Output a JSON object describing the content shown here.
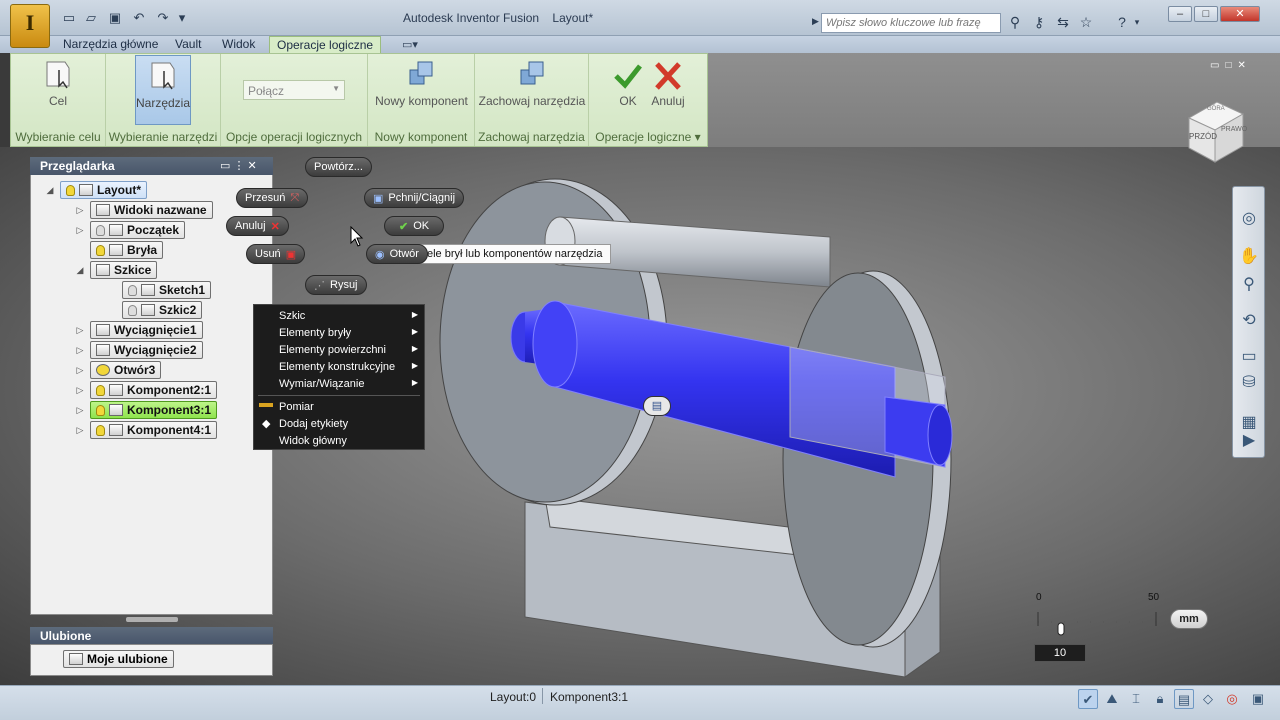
{
  "window": {
    "title": "Autodesk Inventor Fusion",
    "document": "Layout*",
    "logo_letter": "I",
    "logo_sub": "FT"
  },
  "search": {
    "placeholder": "Wpisz słowo kluczowe lub frazę"
  },
  "menus": [
    "Narzędzia główne",
    "Vault",
    "Widok",
    "Operacje logiczne"
  ],
  "ribbon": {
    "panels": [
      {
        "label": "Wybieranie celu",
        "button": "Cel"
      },
      {
        "label": "Wybieranie narzędzi",
        "button": "Narzędzia"
      },
      {
        "label": "Opcje operacji logicznych",
        "combo_value": "Połącz"
      },
      {
        "label": "Nowy komponent",
        "button": "Nowy komponent"
      },
      {
        "label": "Zachowaj narzędzia",
        "button": "Zachowaj narzędzia"
      },
      {
        "label": "Operacje logiczne",
        "ok": "OK",
        "cancel": "Anuluj"
      }
    ]
  },
  "browser": {
    "title": "Przeglądarka",
    "root": "Layout*",
    "items": [
      {
        "label": "Widoki nazwane"
      },
      {
        "label": "Początek"
      },
      {
        "label": "Bryła"
      },
      {
        "label": "Szkice"
      },
      {
        "label": "Sketch1"
      },
      {
        "label": "Szkic2"
      },
      {
        "label": "Wyciągnięcie1"
      },
      {
        "label": "Wyciągnięcie2"
      },
      {
        "label": "Otwór3"
      },
      {
        "label": "Komponent2:1"
      },
      {
        "label": "Komponent3:1"
      },
      {
        "label": "Komponent4:1"
      }
    ]
  },
  "favorites": {
    "title": "Ulubione",
    "item": "Moje ulubione"
  },
  "marking_menu": {
    "repeat": "Powtórz...",
    "move": "Przesuń",
    "push_pull": "Pchnij/Ciągnij",
    "cancel": "Anuluj",
    "ok": "OK",
    "delete": "Usuń",
    "hole": "Otwór",
    "draw": "Rysuj"
  },
  "context_menu": {
    "items": [
      "Szkic",
      "Elementy bryły",
      "Elementy powierzchni",
      "Elementy konstrukcyjne",
      "Wymiar/Wiązanie"
    ],
    "items2": [
      "Pomiar",
      "Dodaj etykiety",
      "Widok główny"
    ]
  },
  "tooltip": "ele brył lub komponentów narzędzia",
  "viewcube": {
    "top": "GÓRA",
    "front": "PRZÓD",
    "right": "PRAWO"
  },
  "ruler": {
    "min": "0",
    "max": "50",
    "value": "10",
    "unit": "mm"
  },
  "status": {
    "layout": "Layout:0",
    "component": "Komponent3:1"
  },
  "colors": {
    "accent_blue": "#2f2fe0",
    "ribbon_green": "#d8ecc8",
    "ok_green": "#3c9a2c",
    "cancel_red": "#d23a2a"
  }
}
